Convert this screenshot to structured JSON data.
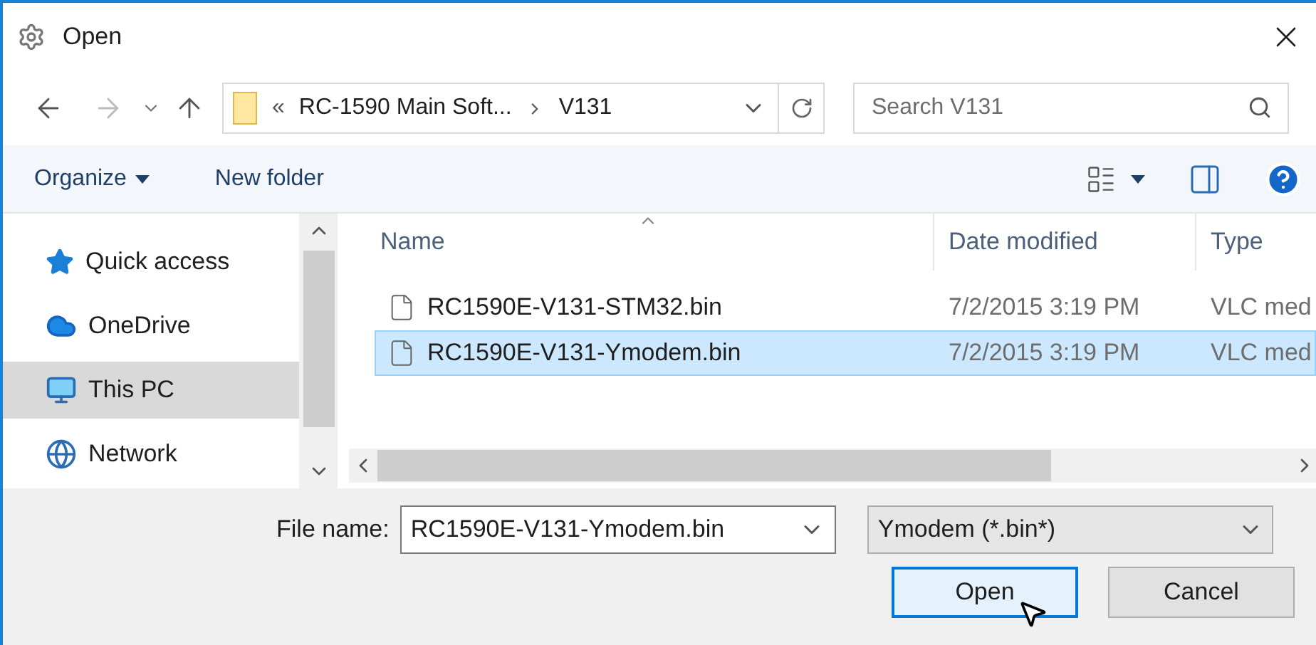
{
  "window": {
    "title": "Open"
  },
  "address": {
    "overflow": "«",
    "segments": [
      "RC-1590 Main Soft...",
      "V131"
    ]
  },
  "search": {
    "placeholder": "Search V131"
  },
  "toolbar": {
    "organize": "Organize",
    "new_folder": "New folder"
  },
  "sidebar": {
    "items": [
      {
        "label": "Quick access",
        "kind": "star",
        "selected": false
      },
      {
        "label": "OneDrive",
        "kind": "cloud",
        "selected": false
      },
      {
        "label": "This PC",
        "kind": "pc",
        "selected": true
      },
      {
        "label": "Network",
        "kind": "network",
        "selected": false
      }
    ]
  },
  "table": {
    "columns": [
      "Name",
      "Date modified",
      "Type"
    ],
    "rows": [
      {
        "name": "RC1590E-V131-STM32.bin",
        "date": "7/2/2015 3:19 PM",
        "type": "VLC med",
        "selected": false
      },
      {
        "name": "RC1590E-V131-Ymodem.bin",
        "date": "7/2/2015 3:19 PM",
        "type": "VLC med",
        "selected": true
      }
    ]
  },
  "file_name": {
    "label": "File name:",
    "value": "RC1590E-V131-Ymodem.bin"
  },
  "filter": {
    "value": "Ymodem (*.bin*)"
  },
  "buttons": [
    {
      "label": "Open",
      "kind": "default"
    },
    {
      "label": "Cancel",
      "kind": "normal"
    }
  ]
}
